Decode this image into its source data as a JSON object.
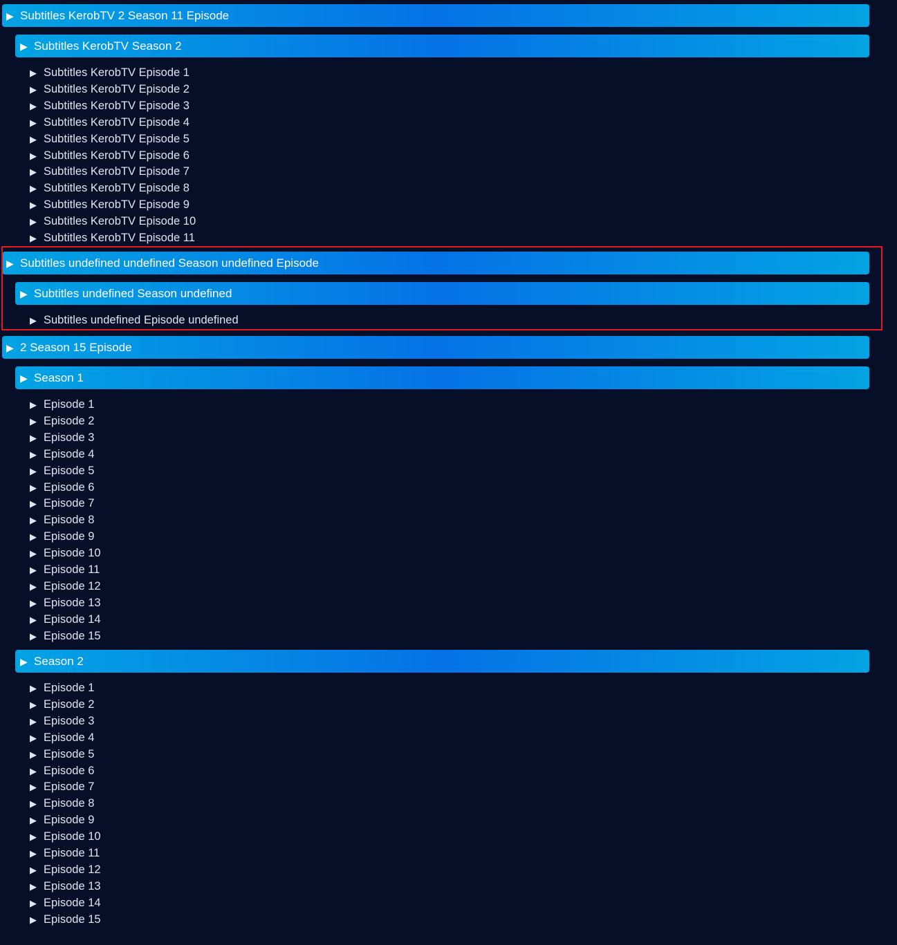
{
  "colors": {
    "background": "#070f28",
    "bar_gradient_edge": "#03a3e3",
    "bar_gradient_center": "#0572e6",
    "highlight_border": "#e21b23",
    "episode_text": "#dfe5ef"
  },
  "icons": {
    "expand": "▶"
  },
  "groups": [
    {
      "label": "Subtitles KerobTV 2 Season 11 Episode",
      "seasons": [
        {
          "label": "Subtitles KerobTV Season 2",
          "episodes": [
            "Subtitles KerobTV Episode 1",
            "Subtitles KerobTV Episode 2",
            "Subtitles KerobTV Episode 3",
            "Subtitles KerobTV Episode 4",
            "Subtitles KerobTV Episode 5",
            "Subtitles KerobTV Episode 6",
            "Subtitles KerobTV Episode 7",
            "Subtitles KerobTV Episode 8",
            "Subtitles KerobTV Episode 9",
            "Subtitles KerobTV Episode 10",
            "Subtitles KerobTV Episode 11"
          ]
        }
      ]
    },
    {
      "label": "Subtitles undefined undefined Season undefined Episode",
      "highlighted": true,
      "seasons": [
        {
          "label": "Subtitles undefined Season undefined",
          "episodes": [
            "Subtitles undefined Episode undefined"
          ]
        }
      ]
    },
    {
      "label": "2 Season 15 Episode",
      "seasons": [
        {
          "label": "Season 1",
          "episodes": [
            "Episode 1",
            "Episode 2",
            "Episode 3",
            "Episode 4",
            "Episode 5",
            "Episode 6",
            "Episode 7",
            "Episode 8",
            "Episode 9",
            "Episode 10",
            "Episode 11",
            "Episode 12",
            "Episode 13",
            "Episode 14",
            "Episode 15"
          ]
        },
        {
          "label": "Season 2",
          "episodes": [
            "Episode 1",
            "Episode 2",
            "Episode 3",
            "Episode 4",
            "Episode 5",
            "Episode 6",
            "Episode 7",
            "Episode 8",
            "Episode 9",
            "Episode 10",
            "Episode 11",
            "Episode 12",
            "Episode 13",
            "Episode 14",
            "Episode 15"
          ]
        }
      ]
    }
  ]
}
